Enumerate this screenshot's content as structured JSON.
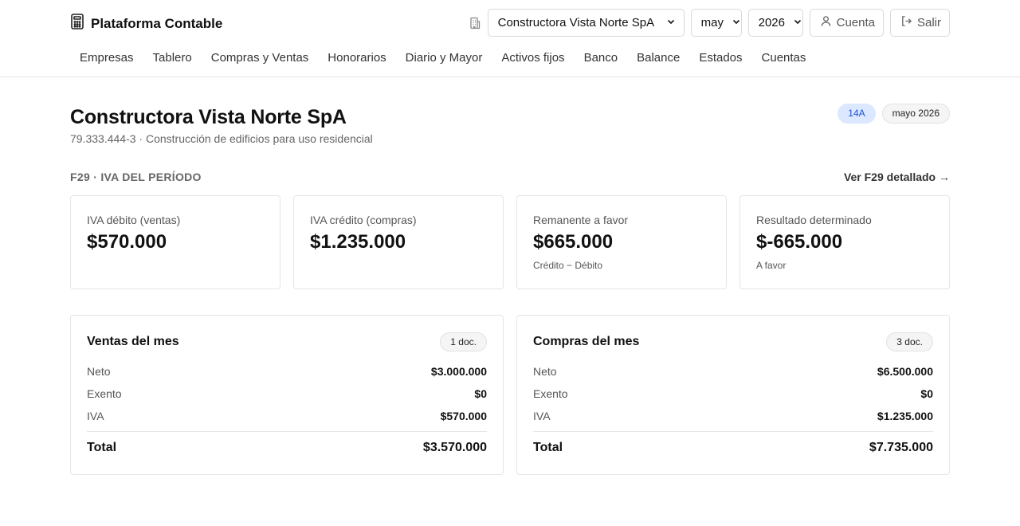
{
  "app": {
    "name": "Plataforma Contable",
    "logo_icon": "calculator-icon"
  },
  "controls": {
    "company_icon": "building-icon",
    "company": {
      "selected": "Constructora Vista Norte SpA"
    },
    "month": {
      "selected": "may"
    },
    "year": {
      "selected": "2026"
    },
    "account_label": "Cuenta",
    "logout_label": "Salir"
  },
  "nav": {
    "items": [
      {
        "label": "Empresas"
      },
      {
        "label": "Tablero"
      },
      {
        "label": "Compras y Ventas"
      },
      {
        "label": "Honorarios"
      },
      {
        "label": "Diario y Mayor"
      },
      {
        "label": "Activos fijos"
      },
      {
        "label": "Banco"
      },
      {
        "label": "Balance"
      },
      {
        "label": "Estados"
      },
      {
        "label": "Cuentas"
      }
    ]
  },
  "page": {
    "title": "Constructora Vista Norte SpA",
    "subtitle": "79.333.444-3 · Construcción de edificios para uso residencial",
    "regime_badge": "14A",
    "period_badge": "mayo 2026"
  },
  "f29": {
    "section_title": "F29 · IVA DEL PERÍODO",
    "detail_link": "Ver F29 detallado →",
    "cards": [
      {
        "label": "IVA débito (ventas)",
        "value": "$570.000",
        "note": ""
      },
      {
        "label": "IVA crédito (compras)",
        "value": "$1.235.000",
        "note": ""
      },
      {
        "label": "Remanente a favor",
        "value": "$665.000",
        "note": "Crédito − Débito"
      },
      {
        "label": "Resultado determinado",
        "value": "$-665.000",
        "note": "A favor"
      }
    ]
  },
  "ventas": {
    "title": "Ventas del mes",
    "docs": "1 doc.",
    "rows": [
      {
        "label": "Neto",
        "value": "$3.000.000"
      },
      {
        "label": "Exento",
        "value": "$0"
      },
      {
        "label": "IVA",
        "value": "$570.000"
      }
    ],
    "total_label": "Total",
    "total_value": "$3.570.000"
  },
  "compras": {
    "title": "Compras del mes",
    "docs": "3 doc.",
    "rows": [
      {
        "label": "Neto",
        "value": "$6.500.000"
      },
      {
        "label": "Exento",
        "value": "$0"
      },
      {
        "label": "IVA",
        "value": "$1.235.000"
      }
    ],
    "total_label": "Total",
    "total_value": "$7.735.000"
  }
}
